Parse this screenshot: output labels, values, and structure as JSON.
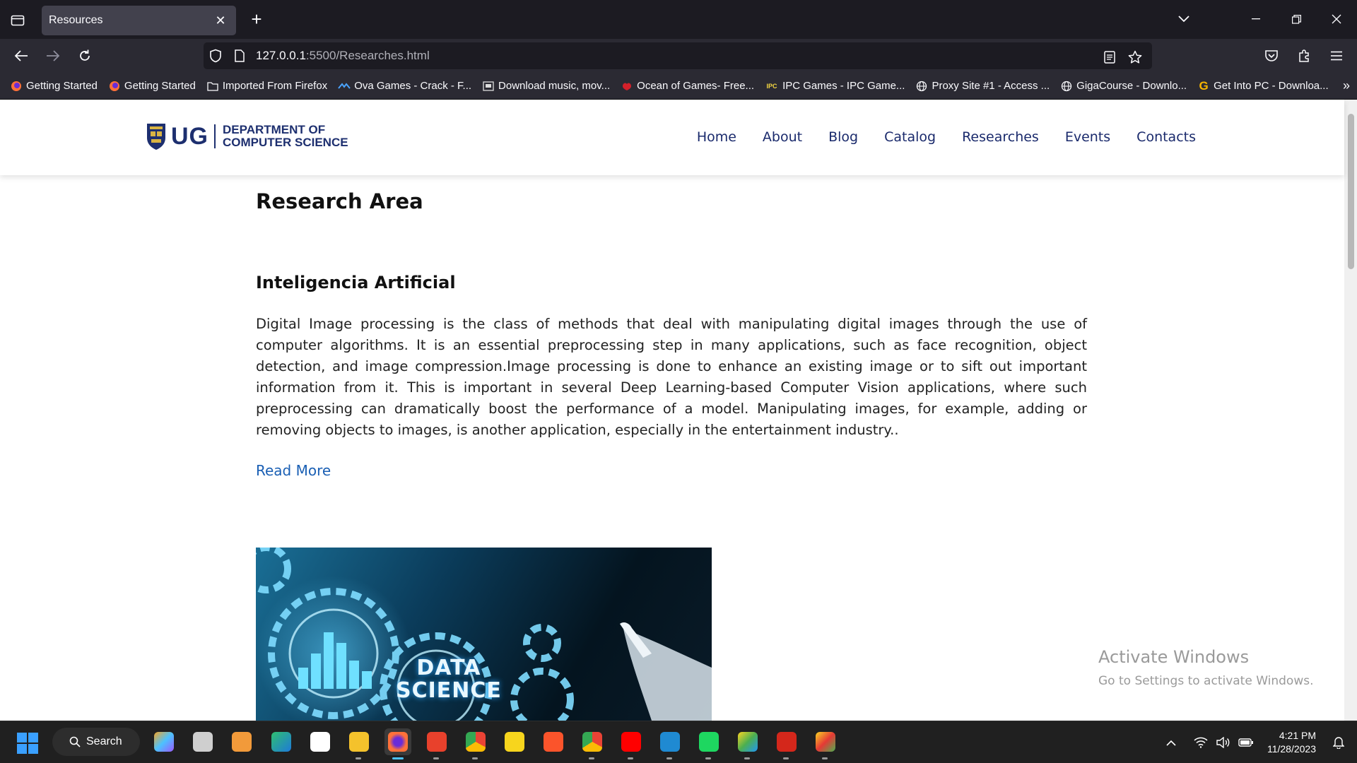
{
  "browser": {
    "tab_title": "Resources",
    "url_host": "127.0.0.1",
    "url_rest": ":5500/Researches.html",
    "bookmarks": [
      {
        "label": "Getting Started",
        "icon": "firefox-icon",
        "color": "#ff7139"
      },
      {
        "label": "Getting Started",
        "icon": "firefox-icon",
        "color": "#ff7139"
      },
      {
        "label": "Imported From Firefox",
        "icon": "folder-icon",
        "color": "#fbfbfe"
      },
      {
        "label": "Ova Games - Crack - F...",
        "icon": "ova-games-icon",
        "color": "#4aa3ff"
      },
      {
        "label": "Download music, mov...",
        "icon": "download-site-icon",
        "color": "#dddddd"
      },
      {
        "label": "Ocean of Games- Free...",
        "icon": "ocean-games-icon",
        "color": "#d3202a"
      },
      {
        "label": "IPC Games - IPC Game...",
        "icon": "ipc-games-icon",
        "color": "#f5d742"
      },
      {
        "label": "Proxy Site #1 - Access ...",
        "icon": "globe-icon",
        "color": "#fbfbfe"
      },
      {
        "label": "GigaCourse - Downlo...",
        "icon": "globe-icon",
        "color": "#fbfbfe"
      },
      {
        "label": "Get Into PC - Downloa...",
        "icon": "getintopc-icon",
        "color": "#f7b500"
      }
    ]
  },
  "site": {
    "logo_ug": "UG",
    "logo_dept_line1": "DEPARTMENT OF",
    "logo_dept_line2": "COMPUTER SCIENCE",
    "nav": [
      "Home",
      "About",
      "Blog",
      "Catalog",
      "Researches",
      "Events",
      "Contacts"
    ],
    "brand_color": "#1d2f6f",
    "link_color": "#1a5fb4"
  },
  "content": {
    "page_title": "Research Area",
    "section_title": "Inteligencia Artificial",
    "section_text": "Digital Image processing is the class of methods that deal with manipulating digital images through the use of computer algorithms. It is an essential preprocessing step in many applications, such as face recognition, object detection, and image compression.Image processing is done to enhance an existing image or to sift out important information from it. This is important in several Deep Learning-based Computer Vision applications, where such preprocessing can dramatically boost the performance of a model. Manipulating images, for example, adding or removing objects to images, is another application, especially in the entertainment industry..",
    "read_more": "Read More",
    "image_text_line1": "DATA",
    "image_text_line2": "SCIENCE"
  },
  "watermark": {
    "title": "Activate Windows",
    "subtitle": "Go to Settings to activate Windows."
  },
  "taskbar": {
    "search_label": "Search",
    "time": "4:21 PM",
    "date": "11/28/2023"
  }
}
